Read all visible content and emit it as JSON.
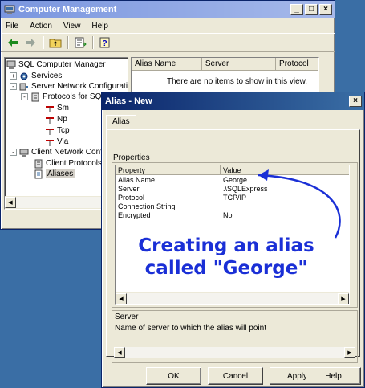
{
  "main_window": {
    "title": "Computer Management",
    "menu": [
      "File",
      "Action",
      "View",
      "Help"
    ],
    "tree": [
      {
        "label": "SQL Computer Manager",
        "icon": "server-manager-icon",
        "level": 0,
        "expander": ""
      },
      {
        "label": "Services",
        "icon": "services-gear-icon",
        "level": 1,
        "expander": "+"
      },
      {
        "label": "Server Network Configuratio",
        "icon": "network-config-icon",
        "level": 1,
        "expander": "-"
      },
      {
        "label": "Protocols for SQL",
        "icon": "protocols-icon",
        "level": 2,
        "expander": "-"
      },
      {
        "label": "Sm",
        "icon": "protocol-icon",
        "level": 3,
        "expander": ""
      },
      {
        "label": "Np",
        "icon": "protocol-icon",
        "level": 3,
        "expander": ""
      },
      {
        "label": "Tcp",
        "icon": "protocol-icon",
        "level": 3,
        "expander": ""
      },
      {
        "label": "Via",
        "icon": "protocol-icon",
        "level": 3,
        "expander": ""
      },
      {
        "label": "Client Network Configu",
        "icon": "client-network-icon",
        "level": 1,
        "expander": "-"
      },
      {
        "label": "Client Protocols",
        "icon": "client-protocols-icon",
        "level": 2,
        "expander": ""
      },
      {
        "label": "Aliases",
        "icon": "aliases-icon",
        "level": 2,
        "expander": ""
      }
    ],
    "list_columns": [
      "Alias Name",
      "Server",
      "Protocol"
    ],
    "empty_message": "There are no items to show in this view."
  },
  "dialog": {
    "title": "Alias - New",
    "tab": "Alias",
    "properties_group": "Properties",
    "grid_headers": [
      "Property",
      "Value"
    ],
    "rows": [
      {
        "property": "Alias Name",
        "value": "George"
      },
      {
        "property": "Server",
        "value": ".\\SQLExpress"
      },
      {
        "property": "Protocol",
        "value": "TCP/IP"
      },
      {
        "property": "Connection String",
        "value": ""
      },
      {
        "property": "Encrypted",
        "value": "No"
      }
    ],
    "description_title": "Server",
    "description_text": "Name of server to which the alias will point",
    "buttons": {
      "ok": "OK",
      "cancel": "Cancel",
      "apply": "Apply",
      "help": "Help"
    }
  },
  "annotation": {
    "text_line1": "Creating an alias",
    "text_line2": "called \"George\"",
    "color": "#1a2fd6"
  },
  "colors": {
    "desktop": "#3a6ea5",
    "window_face": "#ece9d8",
    "active_title": "#0a246a"
  }
}
